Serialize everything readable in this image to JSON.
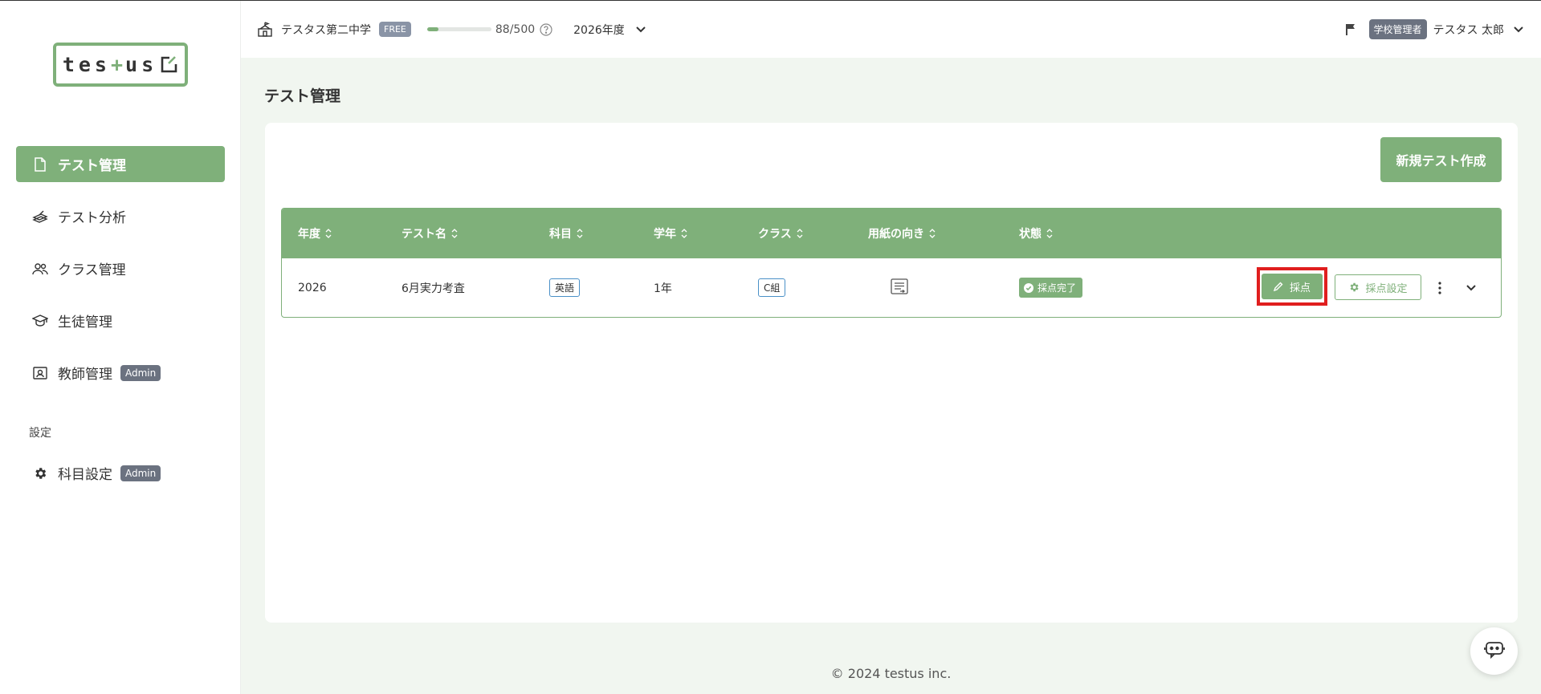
{
  "colors": {
    "accent": "#7fb07a",
    "highlight": "#e01e1e",
    "admin_badge": "#6b7280"
  },
  "sidebar": {
    "logo": {
      "part1": "tes",
      "plus": "+",
      "part2": "us"
    },
    "items": [
      {
        "label": "テスト管理",
        "icon": "document-icon",
        "active": true
      },
      {
        "label": "テスト分析",
        "icon": "pen-paper-icon",
        "active": false
      },
      {
        "label": "クラス管理",
        "icon": "users-icon",
        "active": false
      },
      {
        "label": "生徒管理",
        "icon": "graduation-cap-icon",
        "active": false
      },
      {
        "label": "教師管理",
        "icon": "id-card-icon",
        "active": false,
        "badge": "Admin"
      }
    ],
    "section_label": "設定",
    "settings_items": [
      {
        "label": "科目設定",
        "icon": "gear-icon",
        "badge": "Admin"
      }
    ]
  },
  "topbar": {
    "school_name": "テスタス第二中学",
    "plan_badge": "FREE",
    "usage_text": "88/500",
    "usage_fraction": 0.176,
    "year": "2026年度",
    "role_badge": "学校管理者",
    "user_name": "テスタス 太郎"
  },
  "main": {
    "page_title": "テスト管理",
    "new_test_label": "新規テスト作成",
    "table": {
      "headers": [
        "年度",
        "テスト名",
        "科目",
        "学年",
        "クラス",
        "用紙の向き",
        "状態"
      ],
      "rows": [
        {
          "year": "2026",
          "test_name": "6月実力考査",
          "subject": "英語",
          "grade": "1年",
          "class": "C組",
          "orientation_icon": "portrait-document-icon",
          "status": "採点完了",
          "grade_button": "採点",
          "settings_button": "採点設定"
        }
      ]
    }
  },
  "footer": {
    "copyright": "© 2024 testus inc."
  }
}
